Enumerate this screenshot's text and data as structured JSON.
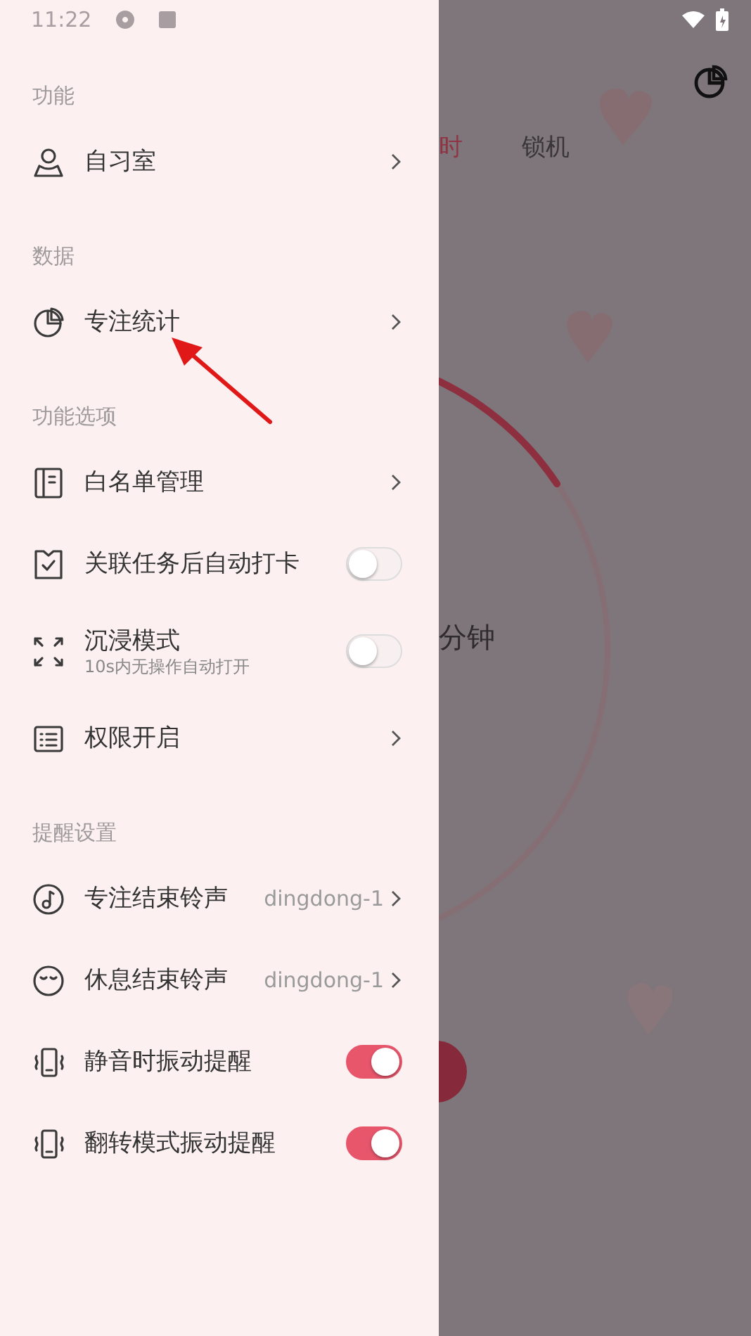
{
  "status_bar": {
    "time": "11:22"
  },
  "drawer": {
    "sections": [
      {
        "title": "功能",
        "items": [
          {
            "kind": "link",
            "label": "自习室"
          }
        ]
      },
      {
        "title": "数据",
        "items": [
          {
            "kind": "link",
            "label": "专注统计"
          }
        ]
      },
      {
        "title": "功能选项",
        "items": [
          {
            "kind": "link",
            "label": "白名单管理"
          },
          {
            "kind": "toggle",
            "label": "关联任务后自动打卡",
            "on": false
          },
          {
            "kind": "toggle",
            "label": "沉浸模式",
            "subtitle": "10s内无操作自动打开",
            "on": false
          },
          {
            "kind": "link",
            "label": "权限开启"
          }
        ]
      },
      {
        "title": "提醒设置",
        "items": [
          {
            "kind": "choice",
            "label": "专注结束铃声",
            "value": "dingdong-1"
          },
          {
            "kind": "choice",
            "label": "休息结束铃声",
            "value": "dingdong-1"
          },
          {
            "kind": "toggle",
            "label": "静音时振动提醒",
            "on": true
          },
          {
            "kind": "toggle",
            "label": "翻转模式振动提醒",
            "on": true
          }
        ]
      }
    ]
  },
  "background_app": {
    "tabs": [
      {
        "label": "时",
        "selected": true
      },
      {
        "label": "锁机",
        "selected": false
      }
    ],
    "timer_text": "分钟"
  }
}
